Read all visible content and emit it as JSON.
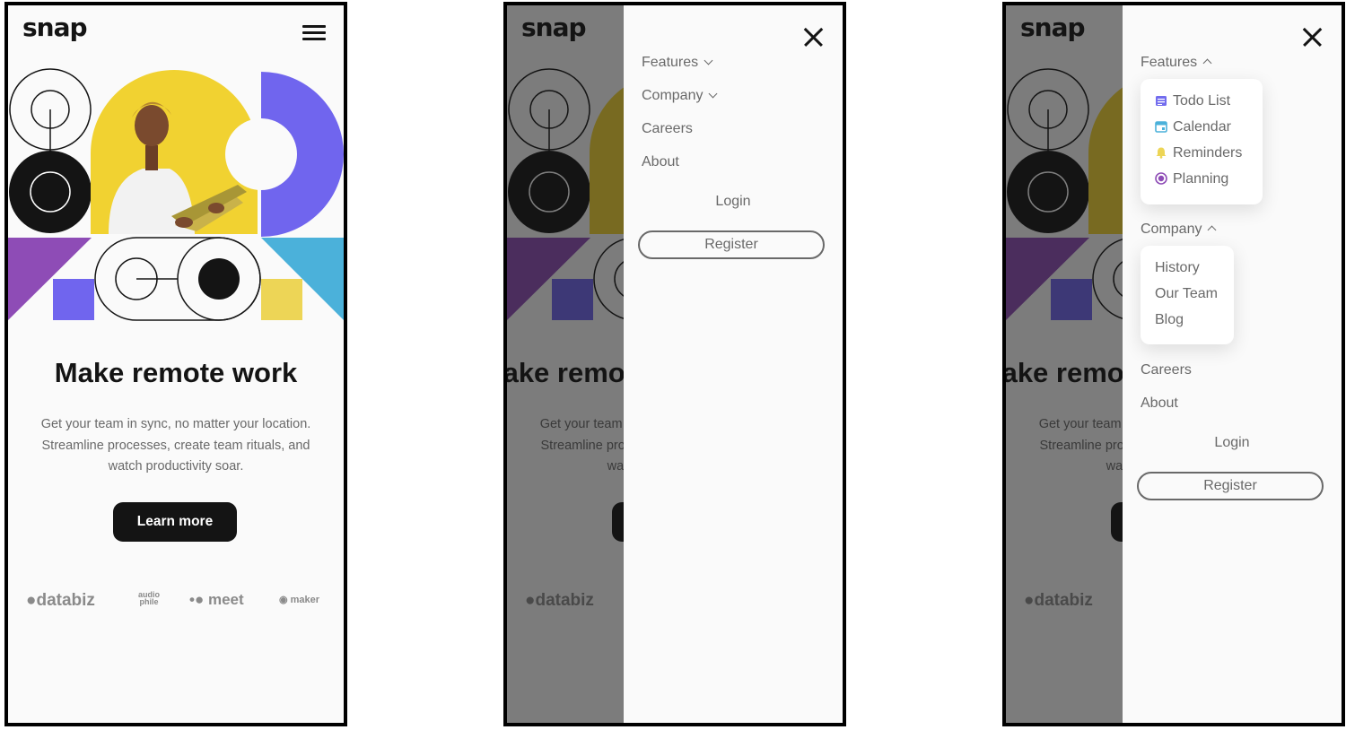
{
  "brand": {
    "logo": "snap"
  },
  "landing": {
    "headline": "Make remote work",
    "subtext": "Get your team in sync, no matter your location. Streamline processes, create team rituals, and watch productivity soar.",
    "cta_label": "Learn more",
    "clients": [
      "databiz",
      "audio phile",
      "meet",
      "maker"
    ]
  },
  "nav": {
    "features_label": "Features",
    "company_label": "Company",
    "careers_label": "Careers",
    "about_label": "About",
    "login_label": "Login",
    "register_label": "Register",
    "features_items": [
      {
        "label": "Todo List",
        "icon": "todo-icon",
        "color": "#726CEE"
      },
      {
        "label": "Calendar",
        "icon": "calendar-icon",
        "color": "#4BB1DA"
      },
      {
        "label": "Reminders",
        "icon": "bell-icon",
        "color": "#EDD556"
      },
      {
        "label": "Planning",
        "icon": "planning-icon",
        "color": "#8E4CB6"
      }
    ],
    "company_items": [
      "History",
      "Our Team",
      "Blog"
    ]
  },
  "colors": {
    "text_dark": "#141414",
    "text_gray": "#696969",
    "yellow": "#F1D231",
    "purple": "#7065EE",
    "violet": "#8E4CB6",
    "blue": "#4BB1DA",
    "light_yellow": "#EDD556"
  }
}
